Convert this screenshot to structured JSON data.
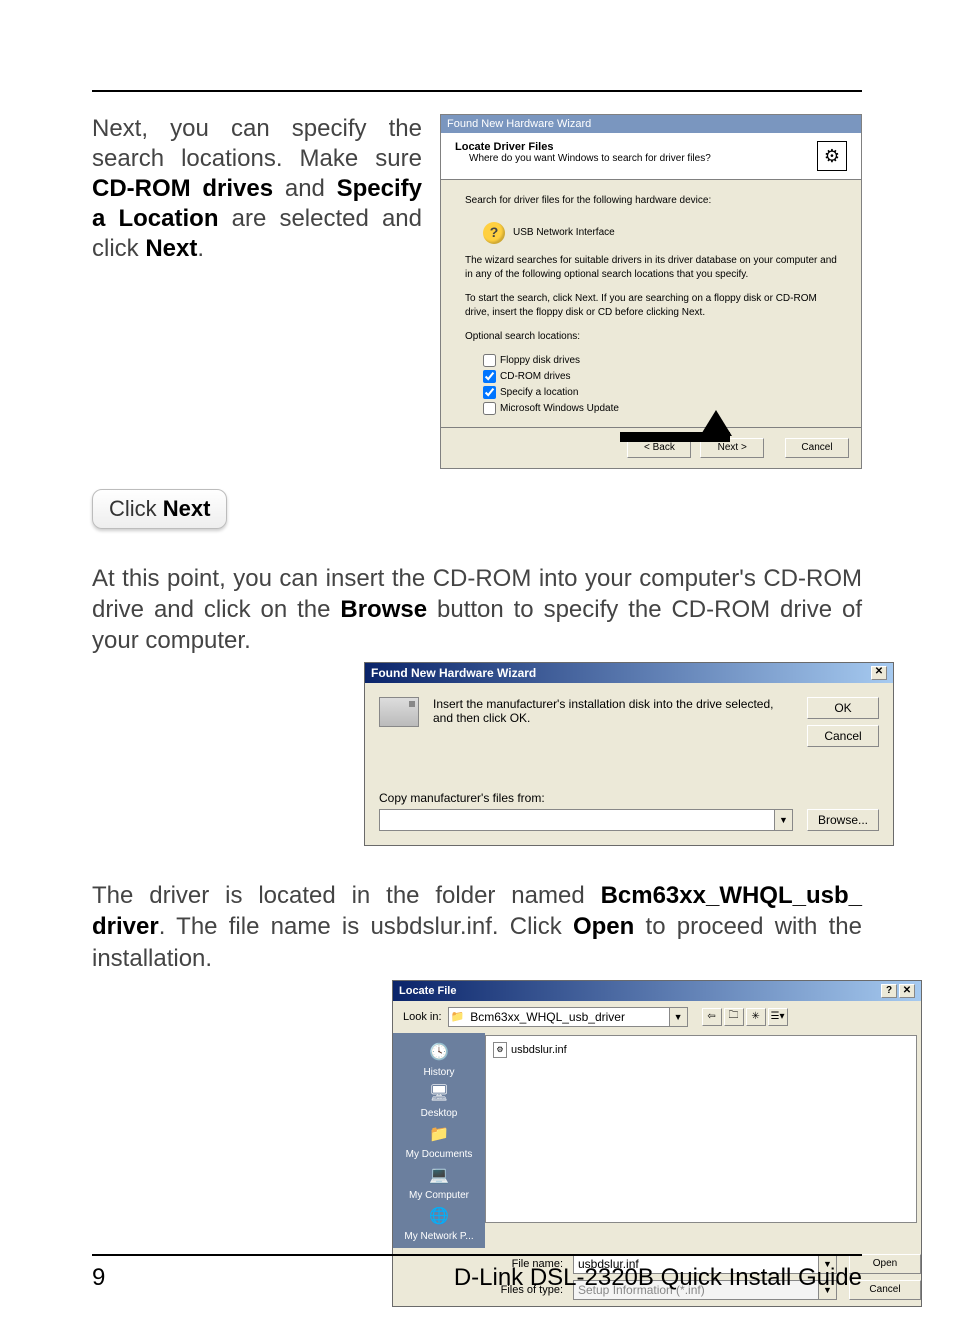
{
  "intro1": {
    "pre": "Next, you can specify the search locations. Make sure ",
    "bold1": "CD-ROM drives",
    "mid1": " and ",
    "bold2": "Specify a Location",
    "mid2": " are selected and click ",
    "bold3": "Next",
    "post": "."
  },
  "wizard1": {
    "windowTitle": "Found New Hardware Wizard",
    "headTitle": "Locate Driver Files",
    "headSub": "Where do you want Windows to search for driver files?",
    "body1": "Search for driver files for the following hardware device:",
    "device": "USB Network Interface",
    "body2": "The wizard searches for suitable drivers in its driver database on your computer and in any of the following optional search locations that you specify.",
    "body3": "To start the search, click Next. If you are searching on a floppy disk or CD-ROM drive, insert the floppy disk or CD before clicking Next.",
    "optLabel": "Optional search locations:",
    "opts": {
      "floppy": "Floppy disk drives",
      "cdrom": "CD-ROM drives",
      "specify": "Specify a location",
      "msu": "Microsoft Windows Update"
    },
    "checked": {
      "floppy": false,
      "cdrom": true,
      "specify": true,
      "msu": false
    },
    "buttons": {
      "back": "< Back",
      "next": "Next >",
      "cancel": "Cancel"
    }
  },
  "callout": {
    "pre": "Click ",
    "bold": "Next"
  },
  "para2": {
    "pre": "At this point, you can insert the CD-ROM into your computer's CD-ROM drive and click on the ",
    "bold": "Browse",
    "post": " button to specify the CD-ROM drive of your computer."
  },
  "dialog2": {
    "title": "Found New Hardware Wizard",
    "msg": "Insert the manufacturer's installation disk into the drive selected, and then click OK.",
    "ok": "OK",
    "cancel": "Cancel",
    "copyLabel": "Copy manufacturer's files from:",
    "value": "",
    "browse": "Browse..."
  },
  "para3": {
    "pre": "The driver is located in the folder named ",
    "bold1": "Bcm63xx_WHQL_usb_ driver",
    "mid": ". The file name is usbdslur.inf. Click ",
    "bold2": "Open",
    "post": " to proceed with the installation."
  },
  "dialog3": {
    "title": "Locate File",
    "lookInLabel": "Look in:",
    "lookInValue": "Bcm63xx_WHQL_usb_driver",
    "toolbar": {
      "back": "⇦",
      "up": "🗀",
      "new": "✳",
      "views": "☰▾"
    },
    "sidebar": [
      {
        "icon": "🕓",
        "label": "History"
      },
      {
        "icon": "🖥",
        "label": "Desktop"
      },
      {
        "icon": "📁",
        "label": "My Documents"
      },
      {
        "icon": "💻",
        "label": "My Computer"
      },
      {
        "icon": "🌐",
        "label": "My Network P..."
      }
    ],
    "file": "usbdslur.inf",
    "fileNameLabel": "File name:",
    "fileNameValue": "usbdslur.inf",
    "fileTypeLabel": "Files of type:",
    "fileTypeValue": "Setup Information (*.inf)",
    "open": "Open",
    "cancel": "Cancel"
  },
  "footer": {
    "page": "9",
    "title": "D-Link DSL-2320B Quick Install Guide"
  }
}
